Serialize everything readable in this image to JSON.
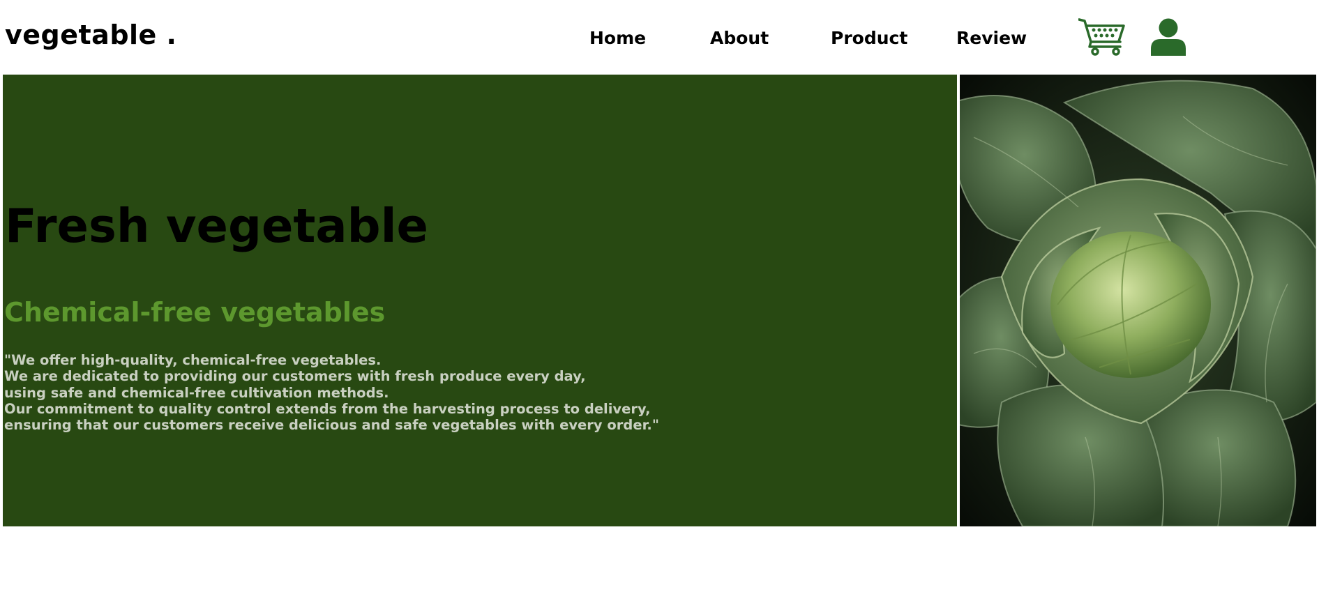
{
  "header": {
    "logo": "vegetable .",
    "nav": [
      {
        "label": "Home"
      },
      {
        "label": "About"
      },
      {
        "label": "Product"
      },
      {
        "label": "Review"
      }
    ],
    "icons": {
      "cart": "shopping-cart-icon",
      "user": "user-icon"
    }
  },
  "hero": {
    "title": "Fresh vegetable",
    "subtitle": "Chemical-free vegetables",
    "description": [
      "\"We offer high-quality, chemical-free vegetables.",
      "We are dedicated to providing our customers with fresh produce every day,",
      "using safe and chemical-free cultivation methods.",
      "Our commitment to quality control extends from the harvesting process to delivery,",
      "ensuring that our customers receive delicious and safe vegetables with every order.\""
    ],
    "image": "cabbage-photo"
  },
  "colors": {
    "hero_background": "#284912",
    "subtitle": "#5d982e",
    "icon_green": "#2a6a2a",
    "description_text": "#c9d0c1"
  }
}
